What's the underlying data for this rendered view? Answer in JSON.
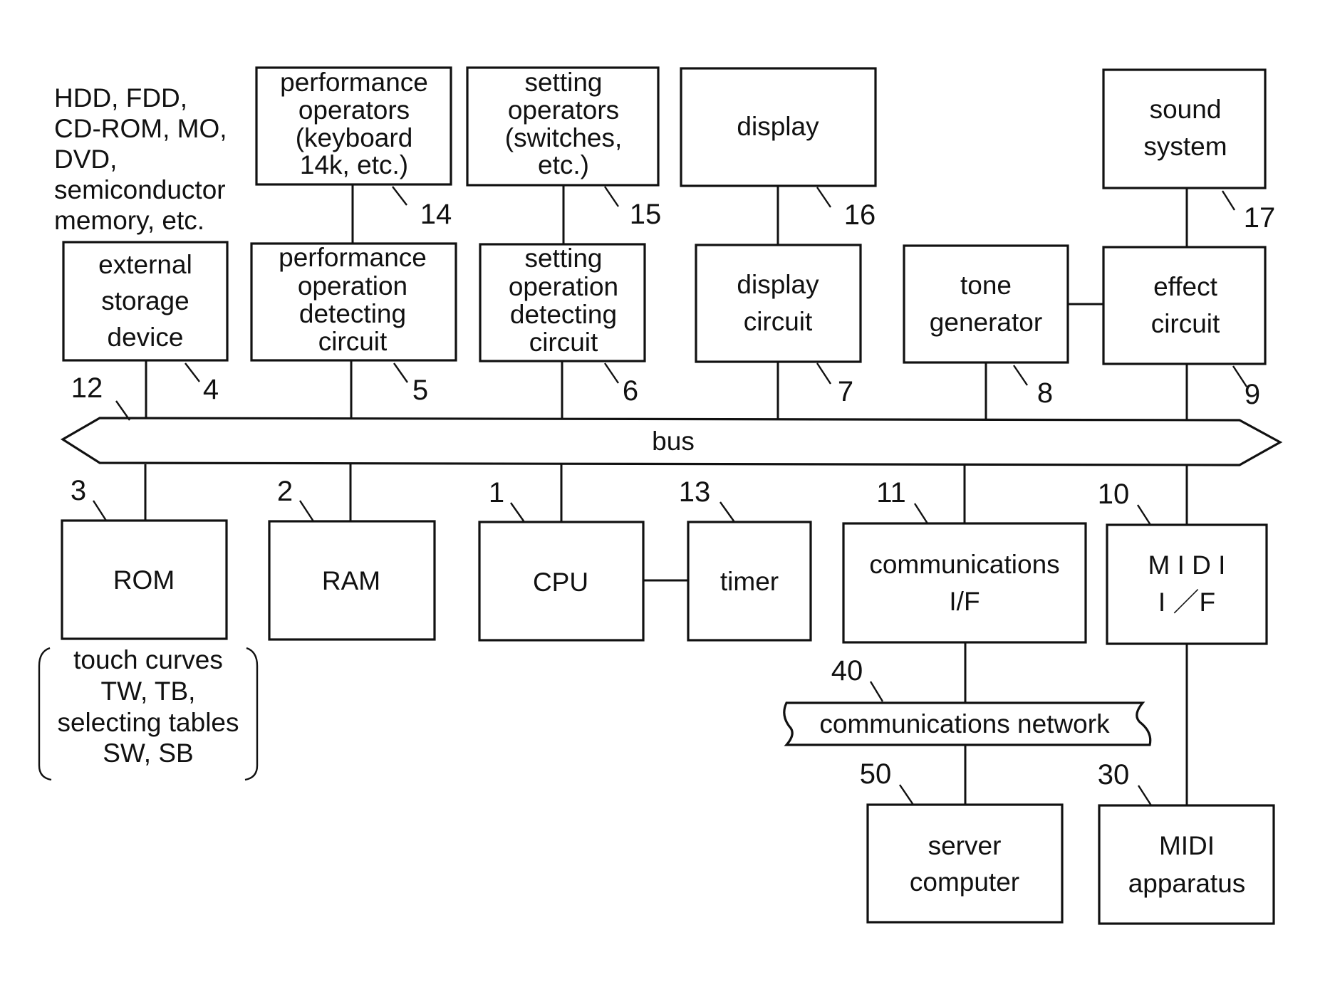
{
  "figure": {
    "bus_label": "bus",
    "bus_ref": "12",
    "storage_media_note": [
      "HDD, FDD,",
      "CD-ROM, MO,",
      "DVD,",
      "semiconductor",
      "memory, etc."
    ],
    "rom_contents_note": [
      "touch curves",
      "TW, TB,",
      "selecting tables",
      "SW, SB"
    ],
    "blocks": {
      "performance_operators": {
        "lines": [
          "performance",
          "operators",
          "(keyboard",
          "14k, etc.)"
        ],
        "ref": "14"
      },
      "setting_operators": {
        "lines": [
          "setting",
          "operators",
          "(switches,",
          "etc.)"
        ],
        "ref": "15"
      },
      "display": {
        "lines": [
          "display"
        ],
        "ref": "16"
      },
      "sound_system": {
        "lines": [
          "sound",
          "system"
        ],
        "ref": "17"
      },
      "external_storage": {
        "lines": [
          "external",
          "storage",
          "device"
        ],
        "ref": "4"
      },
      "performance_detect": {
        "lines": [
          "performance",
          "operation",
          "detecting",
          "circuit"
        ],
        "ref": "5"
      },
      "setting_detect": {
        "lines": [
          "setting",
          "operation",
          "detecting",
          "circuit"
        ],
        "ref": "6"
      },
      "display_circuit": {
        "lines": [
          "display",
          "circuit"
        ],
        "ref": "7"
      },
      "tone_generator": {
        "lines": [
          "tone",
          "generator"
        ],
        "ref": "8"
      },
      "effect_circuit": {
        "lines": [
          "effect",
          "circuit"
        ],
        "ref": "9"
      },
      "rom": {
        "lines": [
          "ROM"
        ],
        "ref": "3"
      },
      "ram": {
        "lines": [
          "RAM"
        ],
        "ref": "2"
      },
      "cpu": {
        "lines": [
          "CPU"
        ],
        "ref": "1"
      },
      "timer": {
        "lines": [
          "timer"
        ],
        "ref": "13"
      },
      "comm_if": {
        "lines": [
          "communications",
          "I/F"
        ],
        "ref": "11"
      },
      "midi_if": {
        "lines": [
          "M I D I",
          "I ／F"
        ],
        "ref": "10"
      },
      "comm_network": {
        "lines": [
          "communications network"
        ],
        "ref": "40"
      },
      "server_computer": {
        "lines": [
          "server",
          "computer"
        ],
        "ref": "50"
      },
      "midi_apparatus": {
        "lines": [
          "MIDI",
          "apparatus"
        ],
        "ref": "30"
      }
    }
  }
}
